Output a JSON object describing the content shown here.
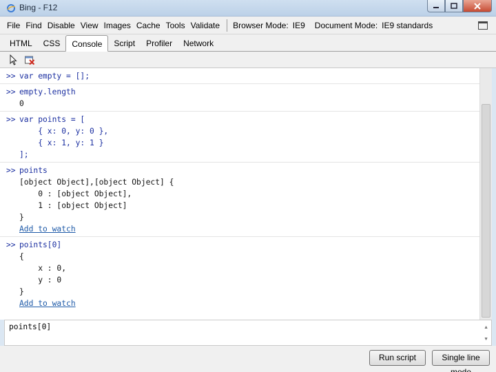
{
  "window": {
    "title": "Bing - F12"
  },
  "menu": {
    "items": [
      "File",
      "Find",
      "Disable",
      "View",
      "Images",
      "Cache",
      "Tools",
      "Validate"
    ],
    "browser_mode_label": "Browser Mode:",
    "browser_mode_value": "IE9",
    "document_mode_label": "Document Mode:",
    "document_mode_value": "IE9 standards"
  },
  "tabs": [
    "HTML",
    "CSS",
    "Console",
    "Script",
    "Profiler",
    "Network"
  ],
  "active_tab": "Console",
  "console": {
    "prompt": ">>",
    "entries": [
      {
        "input": [
          "var empty = [];"
        ],
        "output": []
      },
      {
        "input": [
          "empty.length"
        ],
        "output": [
          "0"
        ]
      },
      {
        "input": [
          "var points = [",
          "    { x: 0, y: 0 },",
          "    { x: 1, y: 1 }",
          "];"
        ],
        "output": []
      },
      {
        "input": [
          "points"
        ],
        "output": [
          "[object Object],[object Object] {",
          "    0 : [object Object],",
          "    1 : [object Object]",
          "}"
        ],
        "link": "Add to watch"
      },
      {
        "input": [
          "points[0]"
        ],
        "output": [
          "{",
          "    x : 0,",
          "    y : 0",
          "}"
        ],
        "link": "Add to watch"
      }
    ]
  },
  "input": {
    "value": "points[0]"
  },
  "buttons": {
    "run": "Run script",
    "single_line": "Single line mode"
  },
  "colors": {
    "accent": "#1a2ea0",
    "link": "#1e5aa8"
  }
}
